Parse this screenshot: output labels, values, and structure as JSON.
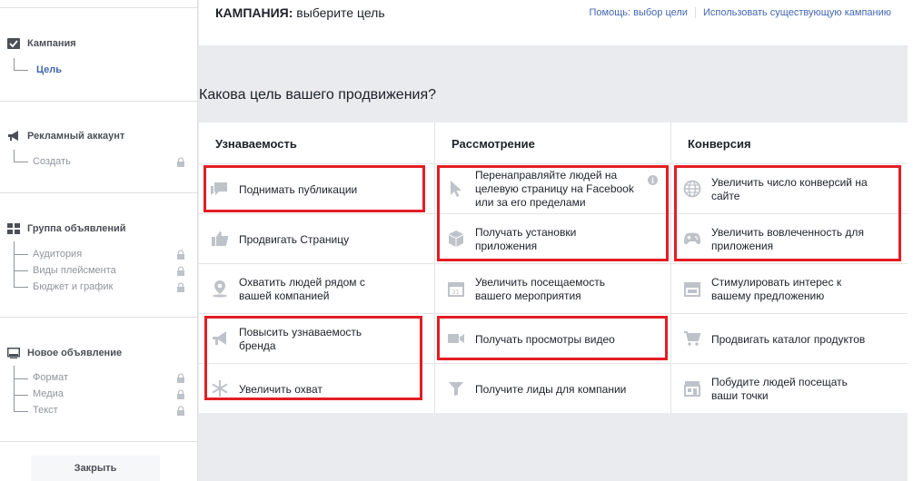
{
  "header": {
    "title_prefix": "КАМПАНИЯ:",
    "title_rest": " выберите цель",
    "help_link": "Помощь: выбор цели",
    "use_existing_link": "Использовать существующую кампанию"
  },
  "sidebar": {
    "campaign": {
      "title": "Кампания",
      "sub": "Цель"
    },
    "ad_account": {
      "title": "Рекламный аккаунт",
      "sub": "Создать"
    },
    "ad_group": {
      "title": "Группа объявлений",
      "items": [
        "Аудитория",
        "Виды плейсмента",
        "Бюджет и график"
      ]
    },
    "new_ad": {
      "title": "Новое объявление",
      "items": [
        "Формат",
        "Медиа",
        "Текст"
      ]
    },
    "close_label": "Закрыть"
  },
  "question": "Какова цель вашего продвижения?",
  "columns": [
    {
      "title": "Узнаваемость",
      "items": [
        {
          "label": "Поднимать публикации",
          "icon": "speech-bubbles-icon"
        },
        {
          "label": "Продвигать Страницу",
          "icon": "thumbs-up-icon"
        },
        {
          "label": "Охватить людей рядом с\nвашей компанией",
          "icon": "map-pin-icon"
        },
        {
          "label": "Повысить узнаваемость\nбренда",
          "icon": "megaphone-icon"
        },
        {
          "label": "Увеличить охват",
          "icon": "snowflake-icon"
        }
      ]
    },
    {
      "title": "Рассмотрение",
      "items": [
        {
          "label": "Перенаправляйте людей на\nцелевую страницу на Facebook\nили за его пределами",
          "icon": "cursor-icon"
        },
        {
          "label": "Получать установки\nприложения",
          "icon": "box-icon"
        },
        {
          "label": "Увеличить посещаемость\nвашего мероприятия",
          "icon": "calendar-icon"
        },
        {
          "label": "Получать просмотры видео",
          "icon": "video-camera-icon"
        },
        {
          "label": "Получите лиды для компании",
          "icon": "funnel-icon"
        }
      ]
    },
    {
      "title": "Конверсия",
      "items": [
        {
          "label": "Увеличить число конверсий на\nсайте",
          "icon": "globe-icon"
        },
        {
          "label": "Увеличить вовлеченность для\nприложения",
          "icon": "gamepad-icon"
        },
        {
          "label": "Стимулировать интерес к\nвашему предложению",
          "icon": "storefront-icon"
        },
        {
          "label": "Продвигать каталог продуктов",
          "icon": "shopping-cart-icon"
        },
        {
          "label": "Побудите людей посещать\nваши точки",
          "icon": "store-icon"
        }
      ]
    }
  ],
  "colors": {
    "link": "#4267b2",
    "highlight": "#e41d24",
    "icon": "#bec2c9"
  }
}
